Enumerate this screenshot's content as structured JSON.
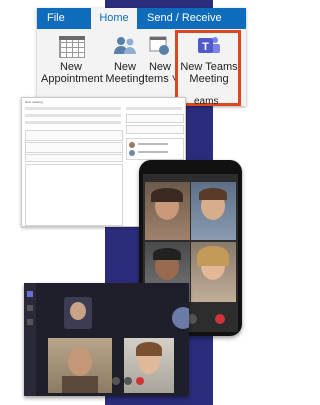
{
  "ribbon": {
    "tabs": [
      "File",
      "Home",
      "Send / Receive"
    ],
    "buttons": {
      "new_appointment": [
        "New",
        "Appointment"
      ],
      "new_meeting": [
        "New",
        "Meeting"
      ],
      "new_items": [
        "New",
        "Items ˅"
      ],
      "new_teams_meeting": [
        "New Teams",
        "Meeting"
      ]
    },
    "group_label": "eams Meeting"
  },
  "colors": {
    "accent_bar": "#2b2d7c",
    "ribbon_tab_bar": "#0f6cbd",
    "teams_highlight": "#d9481f",
    "teams_icon": "#5059c9",
    "hangup": "#d13438"
  },
  "meeting_form": {
    "title": "New meeting"
  },
  "icons": [
    "calendar-icon",
    "people-icon",
    "teams-icon",
    "hang-up-icon",
    "mic-icon",
    "camera-icon"
  ]
}
